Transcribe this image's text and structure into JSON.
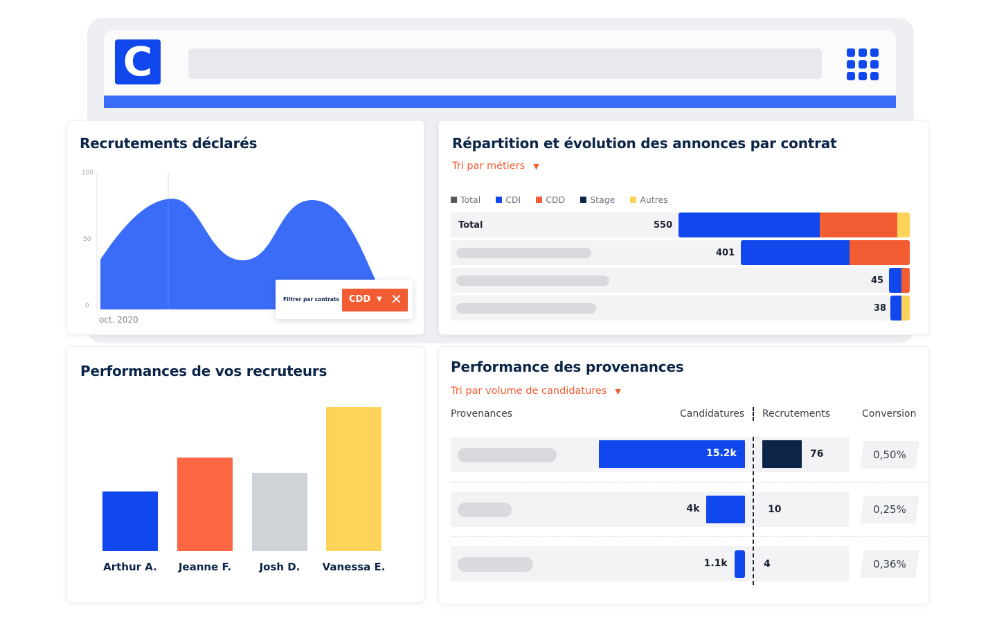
{
  "app": {
    "logo_letter": "C",
    "colors": {
      "brand": "#1048ee",
      "accent_bar": "#3b6ef8",
      "orange": "#f25c33",
      "yellow": "#fdd35a",
      "navy": "#0b2447",
      "grey": "#cfd3d8"
    }
  },
  "hires": {
    "title": "Recrutements déclarés",
    "chart_data": {
      "type": "area",
      "y_ticks": [
        "100",
        "50",
        "0"
      ],
      "ylim": [
        0,
        100
      ],
      "x_label_first": "oct. 2020",
      "values": [
        38,
        80,
        72,
        37,
        80,
        50,
        0
      ]
    },
    "filter": {
      "label": "Filtrer par contrats",
      "value": "CDD",
      "caret_icon": "caret-down-icon",
      "clear_icon": "close-icon"
    }
  },
  "contracts": {
    "title": "Répartition et évolution des annonces par contrat",
    "sort_label": "Tri par métiers",
    "chart_data": {
      "type": "bar",
      "stacked": true,
      "legend": [
        {
          "name": "Total",
          "color": "#555a62"
        },
        {
          "name": "CDI",
          "color": "#1048ee"
        },
        {
          "name": "CDD",
          "color": "#f25c33"
        },
        {
          "name": "Stage",
          "color": "#0b2447"
        },
        {
          "name": "Autres",
          "color": "#fdd35a"
        }
      ],
      "rows": [
        {
          "label": "Total",
          "total": 550,
          "cdi": 336,
          "cdd": 184,
          "autres": 30
        },
        {
          "label": "",
          "total": 401,
          "cdi": 258,
          "cdd": 143,
          "autres": 0
        },
        {
          "label": "",
          "total": 45,
          "cdi": 30,
          "cdd": 15,
          "autres": 0
        },
        {
          "label": "",
          "total": 38,
          "cdi": 26,
          "cdd": 0,
          "autres": 12
        }
      ]
    }
  },
  "recruiters": {
    "title": "Performances de vos recruteurs",
    "chart_data": {
      "type": "bar",
      "categories": [
        "Arthur A.",
        "Jeanne F.",
        "Josh D.",
        "Vanessa E."
      ],
      "values": [
        40,
        63,
        53,
        97
      ],
      "colors": [
        "#1048ee",
        "#ff6644",
        "#cfd3d8",
        "#fdd35a"
      ],
      "ylim": [
        0,
        100
      ]
    }
  },
  "sources": {
    "title": "Performance des provenances",
    "sort_label": "Tri par volume de candidatures",
    "columns": {
      "source": "Provenances",
      "applications": "Candidatures",
      "hires": "Recrutements",
      "conversion": "Conversion"
    },
    "rows": [
      {
        "applications_label": "15.2k",
        "applications": 15200,
        "hires": "76",
        "hires_value": 76,
        "conversion": "0,50%"
      },
      {
        "applications_label": "4k",
        "applications": 4000,
        "hires": "10",
        "hires_value": 10,
        "conversion": "0,25%"
      },
      {
        "applications_label": "1.1k",
        "applications": 1100,
        "hires": "4",
        "hires_value": 4,
        "conversion": "0,36%"
      }
    ]
  }
}
